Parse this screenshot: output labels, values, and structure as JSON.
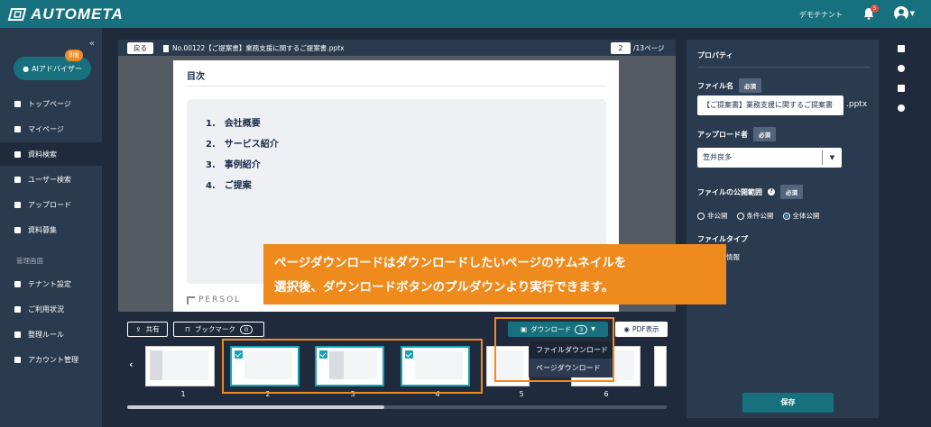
{
  "header": {
    "brand": "AUTOMETA",
    "tenant": "デモテナント",
    "notification_count": "5"
  },
  "sidebar": {
    "ai_button": "AIアドバイザー",
    "beta": "β版",
    "items": [
      {
        "label": "トップページ",
        "icon": "home-icon"
      },
      {
        "label": "マイページ",
        "icon": "user-icon"
      },
      {
        "label": "資料検索",
        "icon": "search-doc-icon",
        "active": true
      },
      {
        "label": "ユーザー検索",
        "icon": "user-search-icon"
      },
      {
        "label": "アップロード",
        "icon": "upload-icon"
      },
      {
        "label": "資料募集",
        "icon": "document-icon"
      }
    ],
    "admin_section": "管理画面",
    "admin_items": [
      {
        "label": "テナント設定",
        "icon": "tenant-icon"
      },
      {
        "label": "ご利用状況",
        "icon": "usage-icon"
      },
      {
        "label": "整理ルール",
        "icon": "rules-icon"
      },
      {
        "label": "アカウント管理",
        "icon": "account-icon"
      }
    ]
  },
  "viewer": {
    "back": "戻る",
    "title": "No.00122【ご提案書】業務支援に関するご提案書.pptx",
    "current_page": "2",
    "total_pages": "/13ページ",
    "page": {
      "heading": "目次",
      "toc": [
        "1.　会社概要",
        "2.　サービス紹介",
        "3.　事例紹介",
        "4.　ご提案"
      ],
      "footer_logo": "PERSOL"
    }
  },
  "toolbar": {
    "share": "共有",
    "bookmark": "ブックマーク",
    "bookmark_count": "0",
    "download": "ダウンロード",
    "download_count": "3",
    "pdf": "PDF表示",
    "menu": [
      "ファイルダウンロード",
      "ページダウンロード"
    ]
  },
  "thumbnails": [
    {
      "num": "1",
      "checked": false
    },
    {
      "num": "2",
      "checked": true
    },
    {
      "num": "3",
      "checked": true
    },
    {
      "num": "4",
      "checked": true
    },
    {
      "num": "5",
      "checked": false
    },
    {
      "num": "6",
      "checked": false
    }
  ],
  "callout": {
    "line1": "ページダウンロードはダウンロードしたいページのサムネイルを",
    "line2": "選択後、ダウンロードボタンのプルダウンより実行できます。"
  },
  "properties": {
    "title": "プロパティ",
    "filename_label": "ファイル名",
    "required": "必須",
    "filename_value": "【ご提案書】業務支援に関するご提案書",
    "ext": ".pptx",
    "uploader_label": "アップロード者",
    "uploader_value": "笠井良多",
    "visibility_label": "ファイルの公開範囲",
    "visibility_options": [
      "非公開",
      "条件公開",
      "全体公開"
    ],
    "filetype_label": "ファイルタイプ",
    "filetype_partial": "情報",
    "save": "保存"
  }
}
